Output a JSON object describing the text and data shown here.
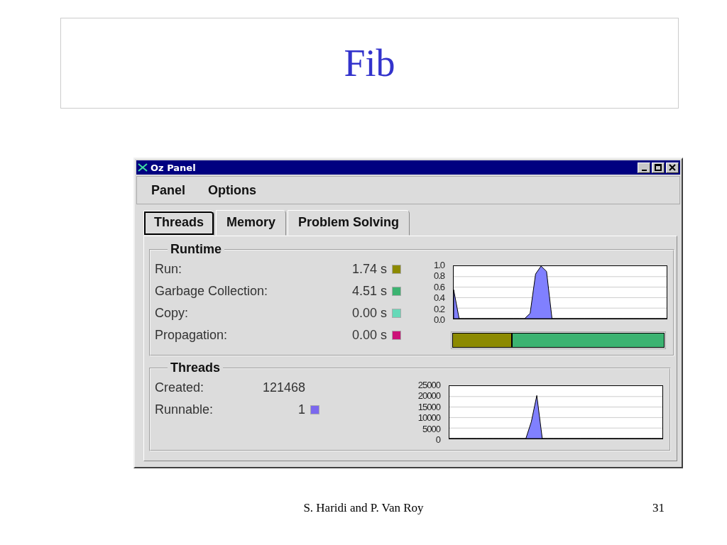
{
  "slide": {
    "title": "Fib",
    "footer": "S. Haridi and P. Van Roy",
    "page_number": "31"
  },
  "window": {
    "title": "Oz Panel"
  },
  "menu": [
    "Panel",
    "Options"
  ],
  "tabs": [
    {
      "label": "Threads",
      "selected": true
    },
    {
      "label": "Memory",
      "selected": false
    },
    {
      "label": "Problem Solving",
      "selected": false
    }
  ],
  "runtime": {
    "title": "Runtime",
    "rows": [
      {
        "label": "Run:",
        "value": "1.74 s",
        "color": "#8c8a00"
      },
      {
        "label": "Garbage Collection:",
        "value": "4.51 s",
        "color": "#3cb371"
      },
      {
        "label": "Copy:",
        "value": "0.00 s",
        "color": "#66d9b8"
      },
      {
        "label": "Propagation:",
        "value": "0.00 s",
        "color": "#cc1177"
      }
    ],
    "time_bar": [
      {
        "color": "#8c8a00",
        "level": 0.28
      },
      {
        "color": "#3cb371",
        "level": 0.72
      }
    ],
    "chart_data": {
      "type": "area",
      "grid": true,
      "ylim": [
        0,
        1
      ],
      "yticks": [
        {
          "value": 0,
          "label": "0.0"
        },
        {
          "value": 0.2,
          "label": "0.2"
        },
        {
          "value": 0.4,
          "label": "0.4"
        },
        {
          "value": 0.6,
          "label": "0.6"
        },
        {
          "value": 0.8,
          "label": "0.8"
        },
        {
          "value": 1,
          "label": "1.0"
        }
      ],
      "series": [
        {
          "color": "#8080ff",
          "values": [
            0.55,
            0,
            0,
            0,
            0,
            0,
            0,
            0,
            0,
            0,
            0,
            0,
            0,
            0,
            0.1,
            0.85,
            1.0,
            0.9,
            0,
            0,
            0,
            0,
            0,
            0,
            0,
            0,
            0,
            0,
            0,
            0,
            0,
            0,
            0,
            0,
            0,
            0,
            0,
            0,
            0,
            0
          ]
        }
      ]
    }
  },
  "threads": {
    "title": "Threads",
    "rows": [
      {
        "label": "Created:",
        "value": "121468"
      },
      {
        "label": "Runnable:",
        "value": "1",
        "color": "#7b68ee"
      }
    ],
    "chart_data": {
      "type": "area",
      "grid": true,
      "ylim": [
        0,
        25000
      ],
      "yticks": [
        0,
        5000,
        10000,
        15000,
        20000,
        25000
      ],
      "series": [
        {
          "color": "#8080ff",
          "values": [
            0,
            0,
            0,
            0,
            0,
            0,
            0,
            0,
            0,
            0,
            0,
            0,
            0,
            0,
            0,
            8000,
            20500,
            0,
            0,
            0,
            0,
            0,
            0,
            0,
            0,
            0,
            0,
            0,
            0,
            0,
            0,
            0,
            0,
            0,
            0,
            0,
            0,
            0,
            0,
            0
          ]
        }
      ]
    }
  }
}
